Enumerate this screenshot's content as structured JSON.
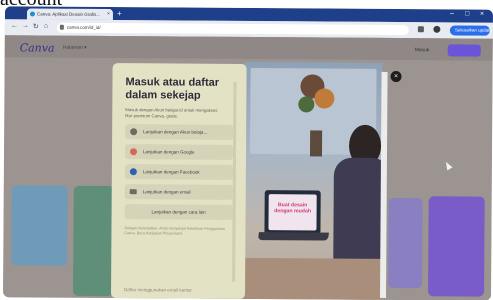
{
  "caption": "account",
  "browser": {
    "tab_title": "Canva: Aplikasi Desain Grafis...",
    "new_tab_symbol": "+",
    "url": "canva.com/id_id/",
    "profile_button": "Selesaikan update",
    "window_controls": [
      "–",
      "□",
      "×"
    ]
  },
  "site": {
    "logo": "Canva",
    "nav_link": "Halaman ▾",
    "login_link": "Masuk"
  },
  "modal": {
    "title": "Masuk atau daftar dalam sekejap",
    "subtitle": "Masuk dengan Akun belajar.id untuk mengakses fitur premium Canva, gratis.",
    "options": [
      {
        "label": "Lanjutkan dengan Akun belaja...",
        "icon": "graduation-cap-icon"
      },
      {
        "label": "Lanjutkan dengan Google",
        "icon": "google-icon"
      },
      {
        "label": "Lanjutkan dengan Facebook",
        "icon": "facebook-icon"
      },
      {
        "label": "Lanjutkan dengan email",
        "icon": "email-icon"
      },
      {
        "label": "Lanjutkan dengan cara lain",
        "icon": ""
      }
    ],
    "fine_print": "Dengan melanjutkan, Anda menyetujui Ketentuan Penggunaan Canva. Baca Kebijakan Privasi kami.",
    "footer": "Daftar menggunakan email kantor"
  },
  "hero_image": {
    "screen_text": "Buat desain dengan mudah"
  },
  "colors": {
    "browser_titlebar": "#1e3f8a",
    "modal_bg": "#e4e2c4",
    "brand_purple": "#6a55d8",
    "screen_text": "#d23a74"
  }
}
